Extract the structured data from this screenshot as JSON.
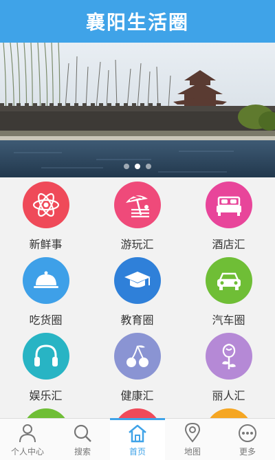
{
  "header": {
    "title": "襄阳生活圈"
  },
  "banner": {
    "dots": 3,
    "active_dot": 1
  },
  "grid": {
    "items": [
      {
        "label": "新鲜事",
        "color": "#ef4a59",
        "icon": "atom-icon"
      },
      {
        "label": "游玩汇",
        "color": "#ef4a7a",
        "icon": "beach-umbrella-icon"
      },
      {
        "label": "酒店汇",
        "color": "#e8459a",
        "icon": "bed-icon"
      },
      {
        "label": "吃货圈",
        "color": "#3ea0e8",
        "icon": "food-cloche-icon"
      },
      {
        "label": "教育圈",
        "color": "#2f80d9",
        "icon": "graduation-cap-icon"
      },
      {
        "label": "汽车圈",
        "color": "#6fbe36",
        "icon": "car-icon"
      },
      {
        "label": "娱乐汇",
        "color": "#28b4c4",
        "icon": "headphones-icon"
      },
      {
        "label": "健康汇",
        "color": "#8a94d3",
        "icon": "cherries-icon"
      },
      {
        "label": "丽人汇",
        "color": "#b589d6",
        "icon": "rose-icon"
      },
      {
        "label": "",
        "color": "#6fbe36",
        "icon": "partial-icon"
      },
      {
        "label": "",
        "color": "#ef4a59",
        "icon": "partial-icon"
      },
      {
        "label": "",
        "color": "#f5a623",
        "icon": "partial-icon"
      }
    ]
  },
  "tabbar": {
    "tabs": [
      {
        "label": "个人中心",
        "icon": "person-icon"
      },
      {
        "label": "搜索",
        "icon": "search-icon"
      },
      {
        "label": "首页",
        "icon": "home-icon"
      },
      {
        "label": "地图",
        "icon": "map-pin-icon"
      },
      {
        "label": "更多",
        "icon": "more-dots-icon"
      }
    ],
    "active": 2
  },
  "colors": {
    "primary": "#3fa3e8",
    "text": "#333333"
  }
}
